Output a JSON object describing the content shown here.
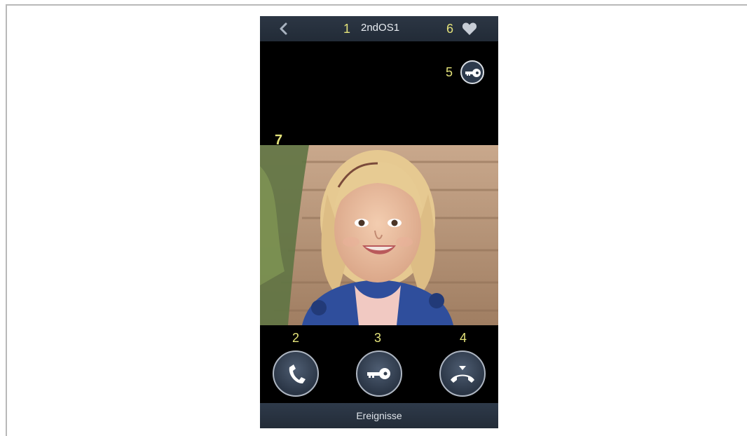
{
  "header": {
    "title": "2ndOS1",
    "back_icon": "chevron-left-icon",
    "favorite_icon": "heart-icon"
  },
  "callouts": {
    "title": "1",
    "accept_call": "2",
    "unlock_door": "3",
    "end_call": "4",
    "unlock_top": "5",
    "favorite": "6",
    "video": "7"
  },
  "actions": {
    "unlock_top_icon": "key-icon",
    "accept_call_icon": "phone-handset-icon",
    "unlock_door_icon": "key-icon",
    "end_call_icon": "hang-up-icon"
  },
  "footer": {
    "label": "Ereignisse"
  },
  "colors": {
    "callout": "#e3e27a",
    "bar": "#2c3644",
    "screen_bg": "#000000"
  }
}
